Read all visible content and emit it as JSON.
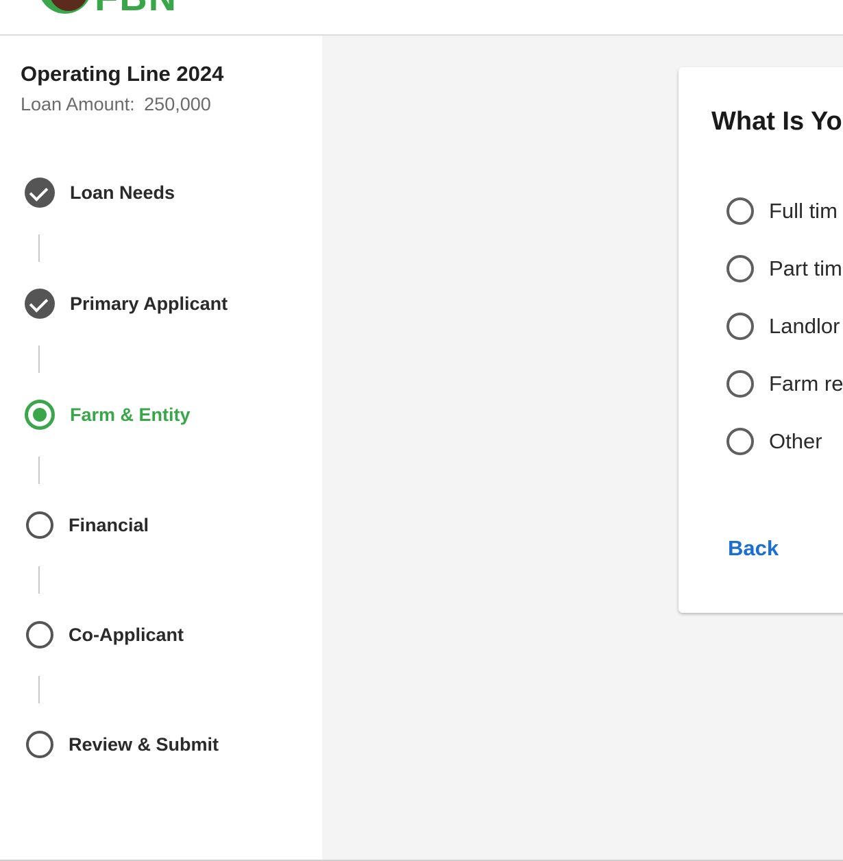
{
  "header": {
    "logo_text": "FBN"
  },
  "sidebar": {
    "loan_title": "Operating Line 2024",
    "loan_amount_label": "Loan Amount:",
    "loan_amount_value": "250,000",
    "steps": [
      {
        "label": "Loan Needs",
        "status": "completed"
      },
      {
        "label": "Primary Applicant",
        "status": "completed"
      },
      {
        "label": "Farm & Entity",
        "status": "active"
      },
      {
        "label": "Financial",
        "status": "pending"
      },
      {
        "label": "Co-Applicant",
        "status": "pending"
      },
      {
        "label": "Review & Submit",
        "status": "pending"
      }
    ]
  },
  "card": {
    "title": "What Is Yo",
    "options": [
      {
        "label": "Full tim",
        "selected": false
      },
      {
        "label": "Part tim",
        "selected": false
      },
      {
        "label": "Landlor",
        "selected": false
      },
      {
        "label": "Farm re",
        "selected": false
      },
      {
        "label": "Other",
        "selected": false
      }
    ],
    "back_label": "Back"
  },
  "colors": {
    "brand_green": "#3aa64a",
    "logo_brown": "#5b2b1e",
    "link_blue": "#1a6fd1",
    "step_gray": "#555555",
    "main_bg": "#f4f4f4"
  }
}
